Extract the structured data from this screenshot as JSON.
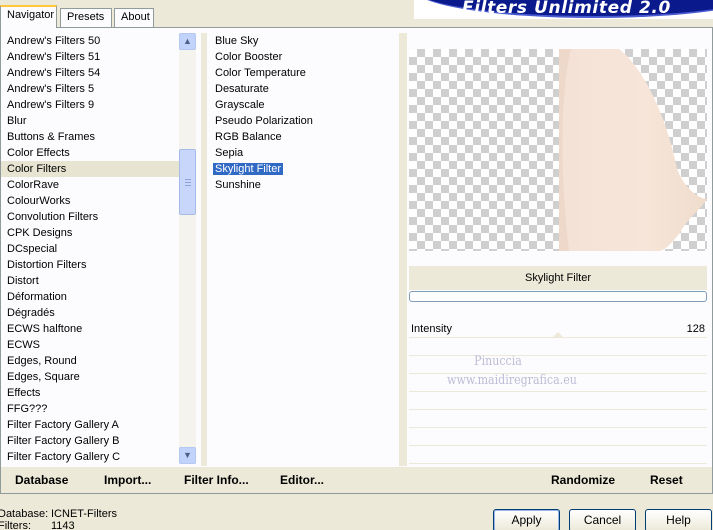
{
  "tabs": [
    "Navigator",
    "Presets",
    "About"
  ],
  "banner_title": "Filters Unlimited 2.0",
  "categories": {
    "items": [
      "Andrew's Filters 50",
      "Andrew's Filters 51",
      "Andrew's Filters 54",
      "Andrew's Filters 5",
      "Andrew's Filters 9",
      "Blur",
      "Buttons & Frames",
      "Color Effects",
      "Color Filters",
      "ColorRave",
      "ColourWorks",
      "Convolution Filters",
      "CPK Designs",
      "DCspecial",
      "Distortion Filters",
      "Distort",
      "Déformation",
      "Dégradés",
      "ECWS halftone",
      "ECWS",
      "Edges, Round",
      "Edges, Square",
      "Effects",
      "FFG???",
      "Filter Factory Gallery A",
      "Filter Factory Gallery B",
      "Filter Factory Gallery C"
    ],
    "selected_index": 8
  },
  "scrollbar": {
    "up_icon": "chevron-up-icon",
    "down_icon": "chevron-down-icon",
    "position": 0.3
  },
  "filters": {
    "items": [
      "Blue Sky",
      "Color Booster",
      "Color Temperature",
      "Desaturate",
      "Grayscale",
      "Pseudo Polarization",
      "RGB Balance",
      "Sepia",
      "Skylight Filter",
      "Sunshine"
    ],
    "selected_index": 8
  },
  "preview": {
    "filter_name": "Skylight Filter",
    "tint_color": "#f4e2d6"
  },
  "sliders": [
    {
      "label": "Intensity",
      "value": "128",
      "level": 0.5
    }
  ],
  "watermark": [
    "Pinuccia",
    "www.maidiregrafica.eu"
  ],
  "bottom_buttons": {
    "database": "Database",
    "import": "Import...",
    "filter_info": "Filter Info...",
    "editor": "Editor...",
    "randomize": "Randomize",
    "reset": "Reset"
  },
  "status": {
    "database_label": "Database:",
    "database_value": "ICNET-Filters",
    "filters_label": "Filters:",
    "filters_value": "1143"
  },
  "dialog_buttons": {
    "apply": "Apply",
    "cancel": "Cancel",
    "help": "Help"
  },
  "colors": {
    "selection": "#316ac5",
    "banner": "#0a1a8c",
    "face": "#ece9d8"
  }
}
